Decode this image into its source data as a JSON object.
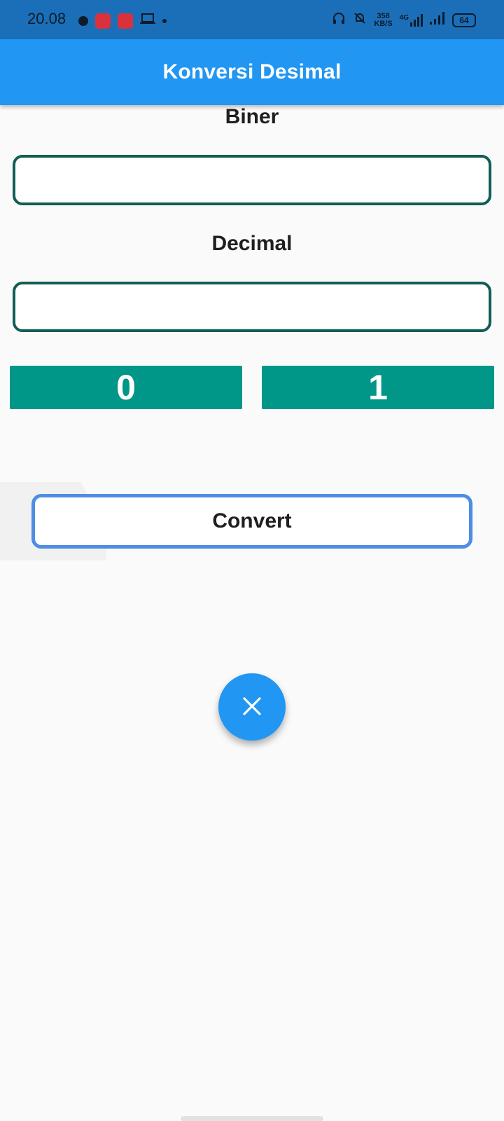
{
  "status_bar": {
    "time": "20.08",
    "net_speed_value": "358",
    "net_speed_unit": "KB/S",
    "network_type": "4G",
    "battery": "64",
    "icons": [
      "record-icon",
      "app-notification-icon",
      "app-notification-icon",
      "laptop-icon",
      "dot-icon",
      "headphones-icon",
      "bell-off-icon",
      "signal-icon",
      "signal-icon",
      "battery-icon"
    ]
  },
  "app_bar": {
    "title": "Konversi Desimal"
  },
  "binary": {
    "label": "Biner",
    "value": "",
    "placeholder": ""
  },
  "decimal": {
    "label": "Decimal",
    "value": "",
    "placeholder": ""
  },
  "digit_buttons": {
    "zero": "0",
    "one": "1"
  },
  "convert_button": {
    "label": "Convert"
  },
  "fab": {
    "icon": "close-icon"
  },
  "colors": {
    "app_bar": "#2196f3",
    "status_bar": "#1b6fb8",
    "field_border": "#115e55",
    "digit_button": "#009688",
    "convert_border": "#4e8de6",
    "fab": "#2196f3",
    "background": "#fafafa"
  }
}
